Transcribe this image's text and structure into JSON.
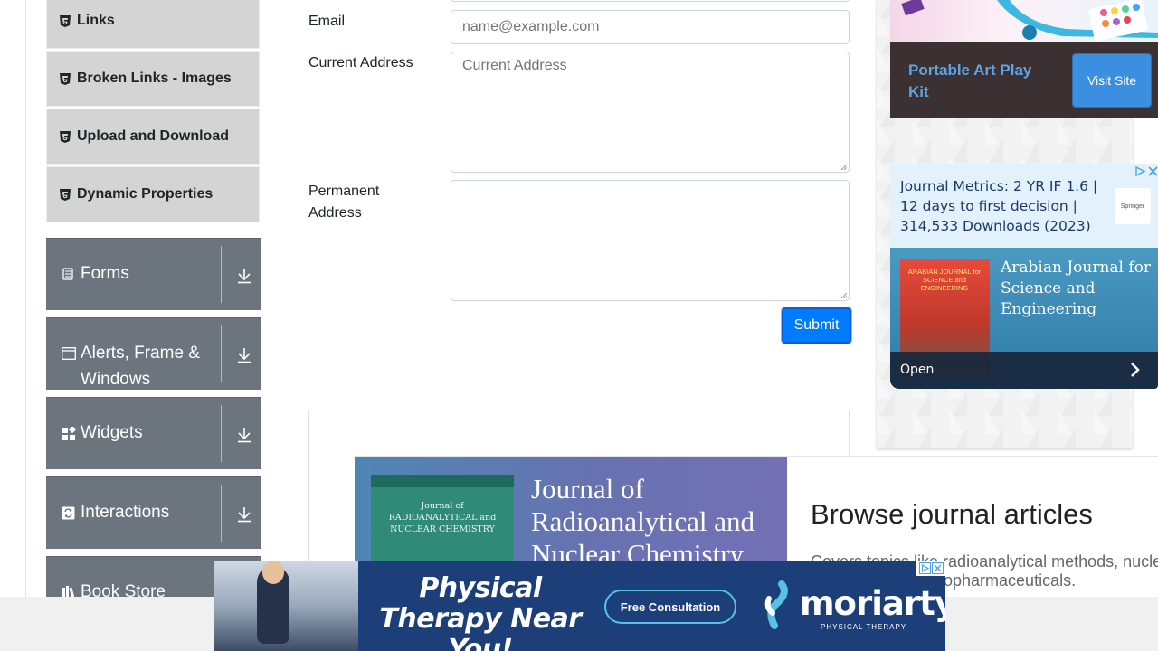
{
  "sidebar": {
    "sub_items": [
      {
        "label": "Links"
      },
      {
        "label": "Broken Links - Images"
      },
      {
        "label": "Upload and Download"
      },
      {
        "label": "Dynamic Properties"
      }
    ],
    "groups": [
      {
        "label": "Forms",
        "icon": "form-icon"
      },
      {
        "label": "Alerts, Frame & Windows",
        "icon": "window-icon"
      },
      {
        "label": "Widgets",
        "icon": "widgets-icon"
      },
      {
        "label": "Interactions",
        "icon": "interactions-icon"
      },
      {
        "label": "Book Store",
        "icon": "books-icon"
      }
    ]
  },
  "form": {
    "email_label": "Email",
    "email_placeholder": "name@example.com",
    "current_address_label": "Current Address",
    "current_address_placeholder": "Current Address",
    "permanent_address_label": "Permanent Address",
    "submit_label": "Submit"
  },
  "ads": {
    "art": {
      "title": "Portable Art Play Kit",
      "button": "Visit Site"
    },
    "journal_metrics": {
      "text": "Journal Metrics: 2 YR IF 1.6 | 12 days to first decision | 314,533 Downloads (2023)",
      "logo": "Springer",
      "cover_text": "ARABIAN JOURNAL for SCIENCE and ENGINEERING",
      "title": "Arabian Journal for Science and Engineering",
      "open_label": "Open"
    },
    "journal": {
      "title": "Journal of Radioanalytical and Nuclear Chemistry",
      "cover_text": "Journal of RADIOANALYTICAL and NUCLEAR CHEMISTRY",
      "browse": "Browse journal articles",
      "desc_line1": "Covers topics like radioanalytical methods, nucle",
      "desc_line2": "opharmaceuticals."
    },
    "physical_therapy": {
      "title": "Physical Therapy Near You!",
      "button": "Free Consultation",
      "logo": "moriarty",
      "logo_sub": "PHYSICAL THERAPY"
    }
  },
  "colors": {
    "sidebar_group_bg": "#6c757d",
    "sidebar_sub_bg": "#d4d4d4",
    "submit_bg": "#007bff",
    "ad_banner_bg": "#1c3f7a"
  }
}
